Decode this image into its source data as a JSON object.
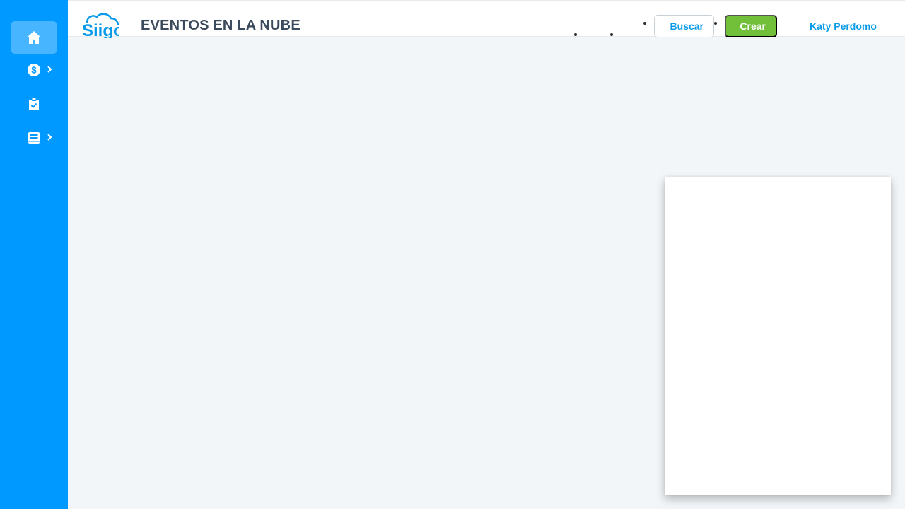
{
  "app": {
    "logo_text": "Siigo",
    "title": "EVENTOS EN LA NUBE"
  },
  "sidebar": {
    "items": [
      {
        "icon": "home-icon",
        "active": true,
        "has_submenu": false
      },
      {
        "icon": "dollar-circle-icon",
        "active": false,
        "has_submenu": true
      },
      {
        "icon": "clipboard-check-icon",
        "active": false,
        "has_submenu": false
      },
      {
        "icon": "book-icon",
        "active": false,
        "has_submenu": true
      }
    ]
  },
  "header": {
    "search_label": "Buscar",
    "create_label": "Crear",
    "user_name": "Katy Perdomo"
  },
  "colors": {
    "sidebar_bg": "#0099ff",
    "accent_blue": "#0a9be8",
    "create_green": "#72c03a",
    "title_text": "#3b4a5c",
    "content_bg": "#f2f6f9"
  }
}
